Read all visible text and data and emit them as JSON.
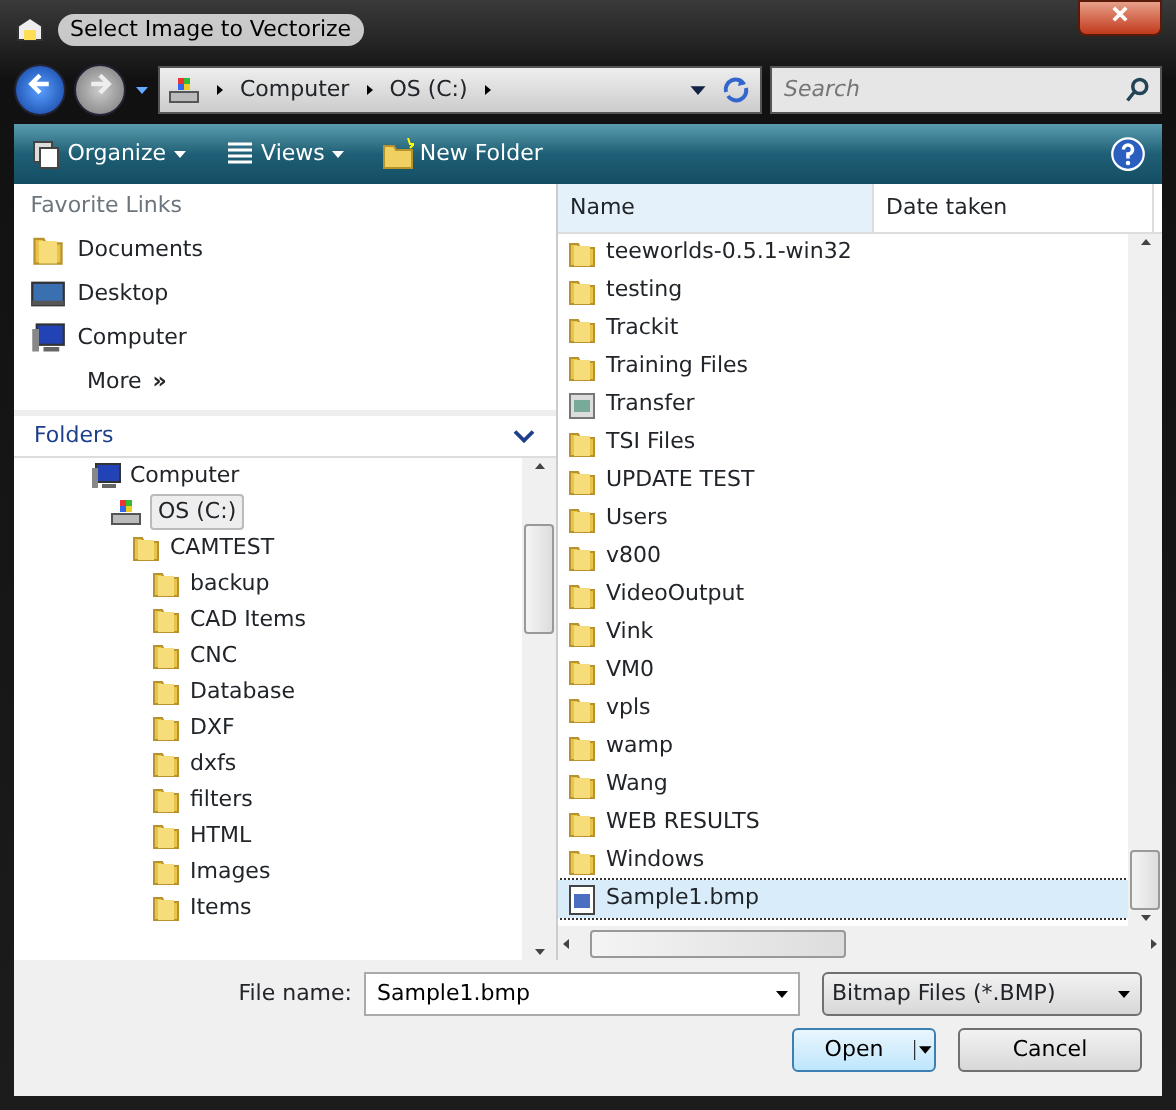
{
  "window": {
    "title": "Select Image to Vectorize"
  },
  "address": {
    "crumbs": [
      "Computer",
      "OS (C:)"
    ]
  },
  "search": {
    "placeholder": "Search"
  },
  "toolbar": [
    {
      "label": "Organize",
      "kind": "organize"
    },
    {
      "label": "Views",
      "kind": "views"
    },
    {
      "label": "New Folder",
      "kind": "newfolder"
    }
  ],
  "favorite_links": {
    "title": "Favorite Links",
    "items": [
      {
        "label": "Documents",
        "kind": "folder"
      },
      {
        "label": "Desktop",
        "kind": "desktop"
      },
      {
        "label": "Computer",
        "kind": "computer"
      }
    ],
    "more": "More",
    "more_glyph": "»"
  },
  "folders": {
    "title": "Folders",
    "tree": [
      {
        "label": "Computer",
        "kind": "computer",
        "selected": false,
        "children": [
          {
            "label": "OS (C:)",
            "kind": "drive",
            "selected": true,
            "children": [
              {
                "label": "CAMTEST",
                "kind": "folder",
                "selected": false,
                "children": [
                  {
                    "label": "backup",
                    "kind": "folder",
                    "selected": false
                  },
                  {
                    "label": "CAD Items",
                    "kind": "folder",
                    "selected": false
                  },
                  {
                    "label": "CNC",
                    "kind": "folder",
                    "selected": false
                  },
                  {
                    "label": "Database",
                    "kind": "folder",
                    "selected": false
                  },
                  {
                    "label": "DXF",
                    "kind": "folder",
                    "selected": false
                  },
                  {
                    "label": "dxfs",
                    "kind": "folder",
                    "selected": false
                  },
                  {
                    "label": "filters",
                    "kind": "folder",
                    "selected": false
                  },
                  {
                    "label": "HTML",
                    "kind": "folder",
                    "selected": false
                  },
                  {
                    "label": "Images",
                    "kind": "folder",
                    "selected": false
                  },
                  {
                    "label": "Items",
                    "kind": "folder",
                    "selected": false
                  }
                ]
              }
            ]
          }
        ]
      }
    ]
  },
  "file_list": {
    "columns": [
      "Name",
      "Date taken"
    ],
    "rows": [
      {
        "name": "teeworlds-0.5.1-win32",
        "kind": "folder",
        "selected": false
      },
      {
        "name": "testing",
        "kind": "folder",
        "selected": false
      },
      {
        "name": "Trackit",
        "kind": "folder",
        "selected": false
      },
      {
        "name": "Training Files",
        "kind": "folder",
        "selected": false
      },
      {
        "name": "Transfer",
        "kind": "app",
        "selected": false
      },
      {
        "name": "TSI Files",
        "kind": "folder",
        "selected": false
      },
      {
        "name": "UPDATE TEST",
        "kind": "folder",
        "selected": false
      },
      {
        "name": "Users",
        "kind": "folder",
        "selected": false
      },
      {
        "name": "v800",
        "kind": "folder",
        "selected": false
      },
      {
        "name": "VideoOutput",
        "kind": "folder",
        "selected": false
      },
      {
        "name": "Vink",
        "kind": "folder",
        "selected": false
      },
      {
        "name": "VM0",
        "kind": "folder",
        "selected": false
      },
      {
        "name": "vpls",
        "kind": "folder",
        "selected": false
      },
      {
        "name": "wamp",
        "kind": "folder",
        "selected": false
      },
      {
        "name": "Wang",
        "kind": "folder",
        "selected": false
      },
      {
        "name": "WEB RESULTS",
        "kind": "folder",
        "selected": false
      },
      {
        "name": "Windows",
        "kind": "folder",
        "selected": false
      },
      {
        "name": "Sample1.bmp",
        "kind": "bitmap",
        "selected": true
      }
    ]
  },
  "file_name": {
    "label": "File name:",
    "value": "Sample1.bmp"
  },
  "file_type": {
    "value": "Bitmap Files (*.BMP)"
  },
  "buttons": [
    {
      "label": "Open",
      "kind": "split"
    },
    {
      "label": "Cancel",
      "kind": "plain"
    }
  ]
}
